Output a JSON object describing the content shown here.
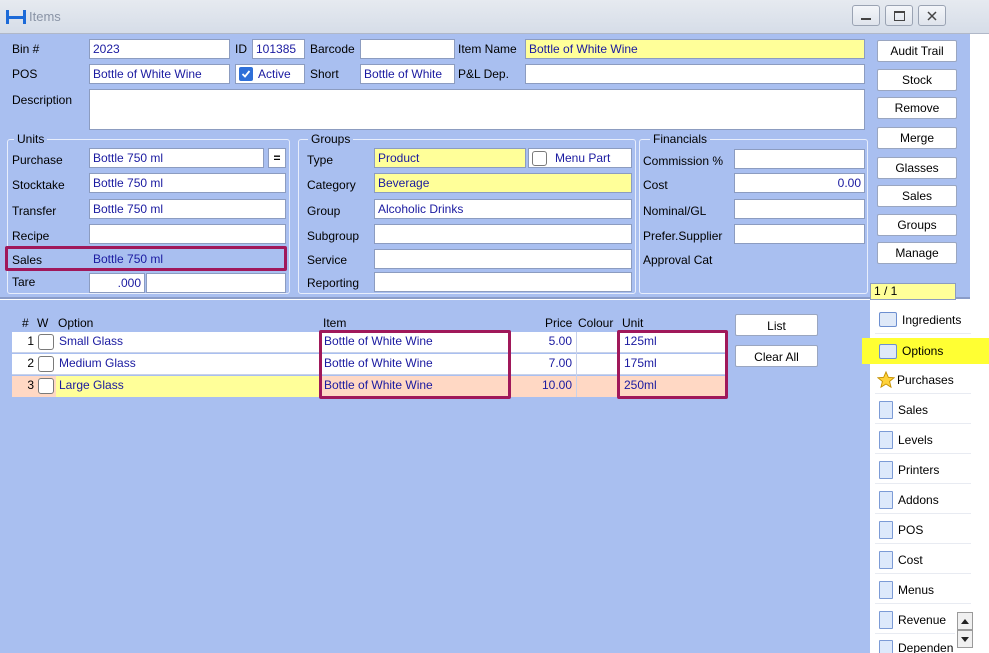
{
  "window": {
    "title": "Items"
  },
  "header": {
    "bin_label": "Bin #",
    "bin_value": "2023",
    "id_label": "ID",
    "id_value": "101385",
    "barcode_label": "Barcode",
    "barcode_value": "",
    "item_name_label": "Item Name",
    "item_name_value": "Bottle of White Wine",
    "pos_label": "POS",
    "pos_value": "Bottle of White Wine",
    "active_label": "Active",
    "active_checked": true,
    "short_label": "Short",
    "short_value": "Bottle of White",
    "pl_dep_label": "P&L Dep.",
    "pl_dep_value": "",
    "description_label": "Description",
    "description_value": ""
  },
  "units": {
    "legend": "Units",
    "purchase_label": "Purchase",
    "purchase_value": "Bottle 750 ml",
    "purchase_btn": "=",
    "stocktake_label": "Stocktake",
    "stocktake_value": "Bottle 750 ml",
    "transfer_label": "Transfer",
    "transfer_value": "Bottle 750 ml",
    "recipe_label": "Recipe",
    "recipe_value": "",
    "sales_label": "Sales",
    "sales_value": "Bottle 750 ml",
    "tare_label": "Tare",
    "tare_value": ".000"
  },
  "groups": {
    "legend": "Groups",
    "type_label": "Type",
    "type_value": "Product",
    "menu_part_label": "Menu Part",
    "category_label": "Category",
    "category_value": "Beverage",
    "group_label": "Group",
    "group_value": "Alcoholic Drinks",
    "subgroup_label": "Subgroup",
    "subgroup_value": "",
    "service_label": "Service",
    "service_value": "",
    "reporting_label": "Reporting",
    "reporting_value": ""
  },
  "financials": {
    "legend": "Financials",
    "commission_label": "Commission %",
    "commission_value": "",
    "cost_label": "Cost",
    "cost_value": "0.00",
    "nominal_label": "Nominal/GL",
    "nominal_value": "",
    "supplier_label": "Prefer.Supplier",
    "supplier_value": "",
    "approval_label": "Approval Cat"
  },
  "actions": [
    "Audit Trail",
    "Stock",
    "Remove",
    "Merge",
    "Glasses",
    "Sales",
    "Groups",
    "Manage"
  ],
  "record_counter": "1 / 1",
  "options_table": {
    "headers": {
      "num": "#",
      "w": "W",
      "option": "Option",
      "item": "Item",
      "price": "Price",
      "colour": "Colour",
      "unit": "Unit"
    },
    "rows": [
      {
        "num": "1",
        "option": "Small Glass",
        "item": "Bottle of White Wine",
        "price": "5.00",
        "unit": "125ml"
      },
      {
        "num": "2",
        "option": "Medium Glass",
        "item": "Bottle of White Wine",
        "price": "7.00",
        "unit": "175ml"
      },
      {
        "num": "3",
        "option": "Large Glass",
        "item": "Bottle of White Wine",
        "price": "10.00",
        "unit": "250ml"
      }
    ],
    "list_btn": "List",
    "clear_all_btn": "Clear All"
  },
  "tabs": [
    "Ingredients",
    "Options",
    "Purchases",
    "Sales",
    "Levels",
    "Printers",
    "Addons",
    "POS",
    "Cost",
    "Menus",
    "Revenue",
    "Dependen"
  ],
  "colors": {
    "panel": "#a9bff0",
    "highlight_yellow": "#ffff99",
    "selected_row": "#ffd8c4",
    "annotation": "#a0185a"
  }
}
